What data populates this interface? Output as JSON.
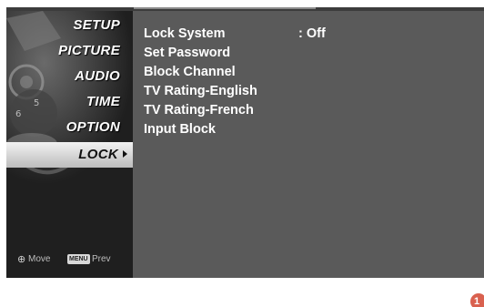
{
  "sidebar": {
    "items": [
      {
        "label": "SETUP",
        "active": false
      },
      {
        "label": "PICTURE",
        "active": false
      },
      {
        "label": "AUDIO",
        "active": false
      },
      {
        "label": "TIME",
        "active": false
      },
      {
        "label": "OPTION",
        "active": false
      },
      {
        "label": "LOCK",
        "active": true
      }
    ]
  },
  "footer": {
    "move_icon": "dpad-icon",
    "move_label": "Move",
    "menu_key": "MENU",
    "prev_label": "Prev"
  },
  "lock_menu": {
    "rows": [
      {
        "label": "Lock System",
        "value": ": Off"
      },
      {
        "label": "Set Password",
        "value": ""
      },
      {
        "label": "Block Channel",
        "value": ""
      },
      {
        "label": "TV Rating-English",
        "value": ""
      },
      {
        "label": "TV Rating-French",
        "value": ""
      },
      {
        "label": "Input Block",
        "value": ""
      }
    ]
  },
  "page_badge": "1",
  "colors": {
    "panel": "#5a5a5a",
    "sidebar": "#1f1f1f",
    "active_item": "#e6e6e6",
    "badge": "#d9614f"
  }
}
